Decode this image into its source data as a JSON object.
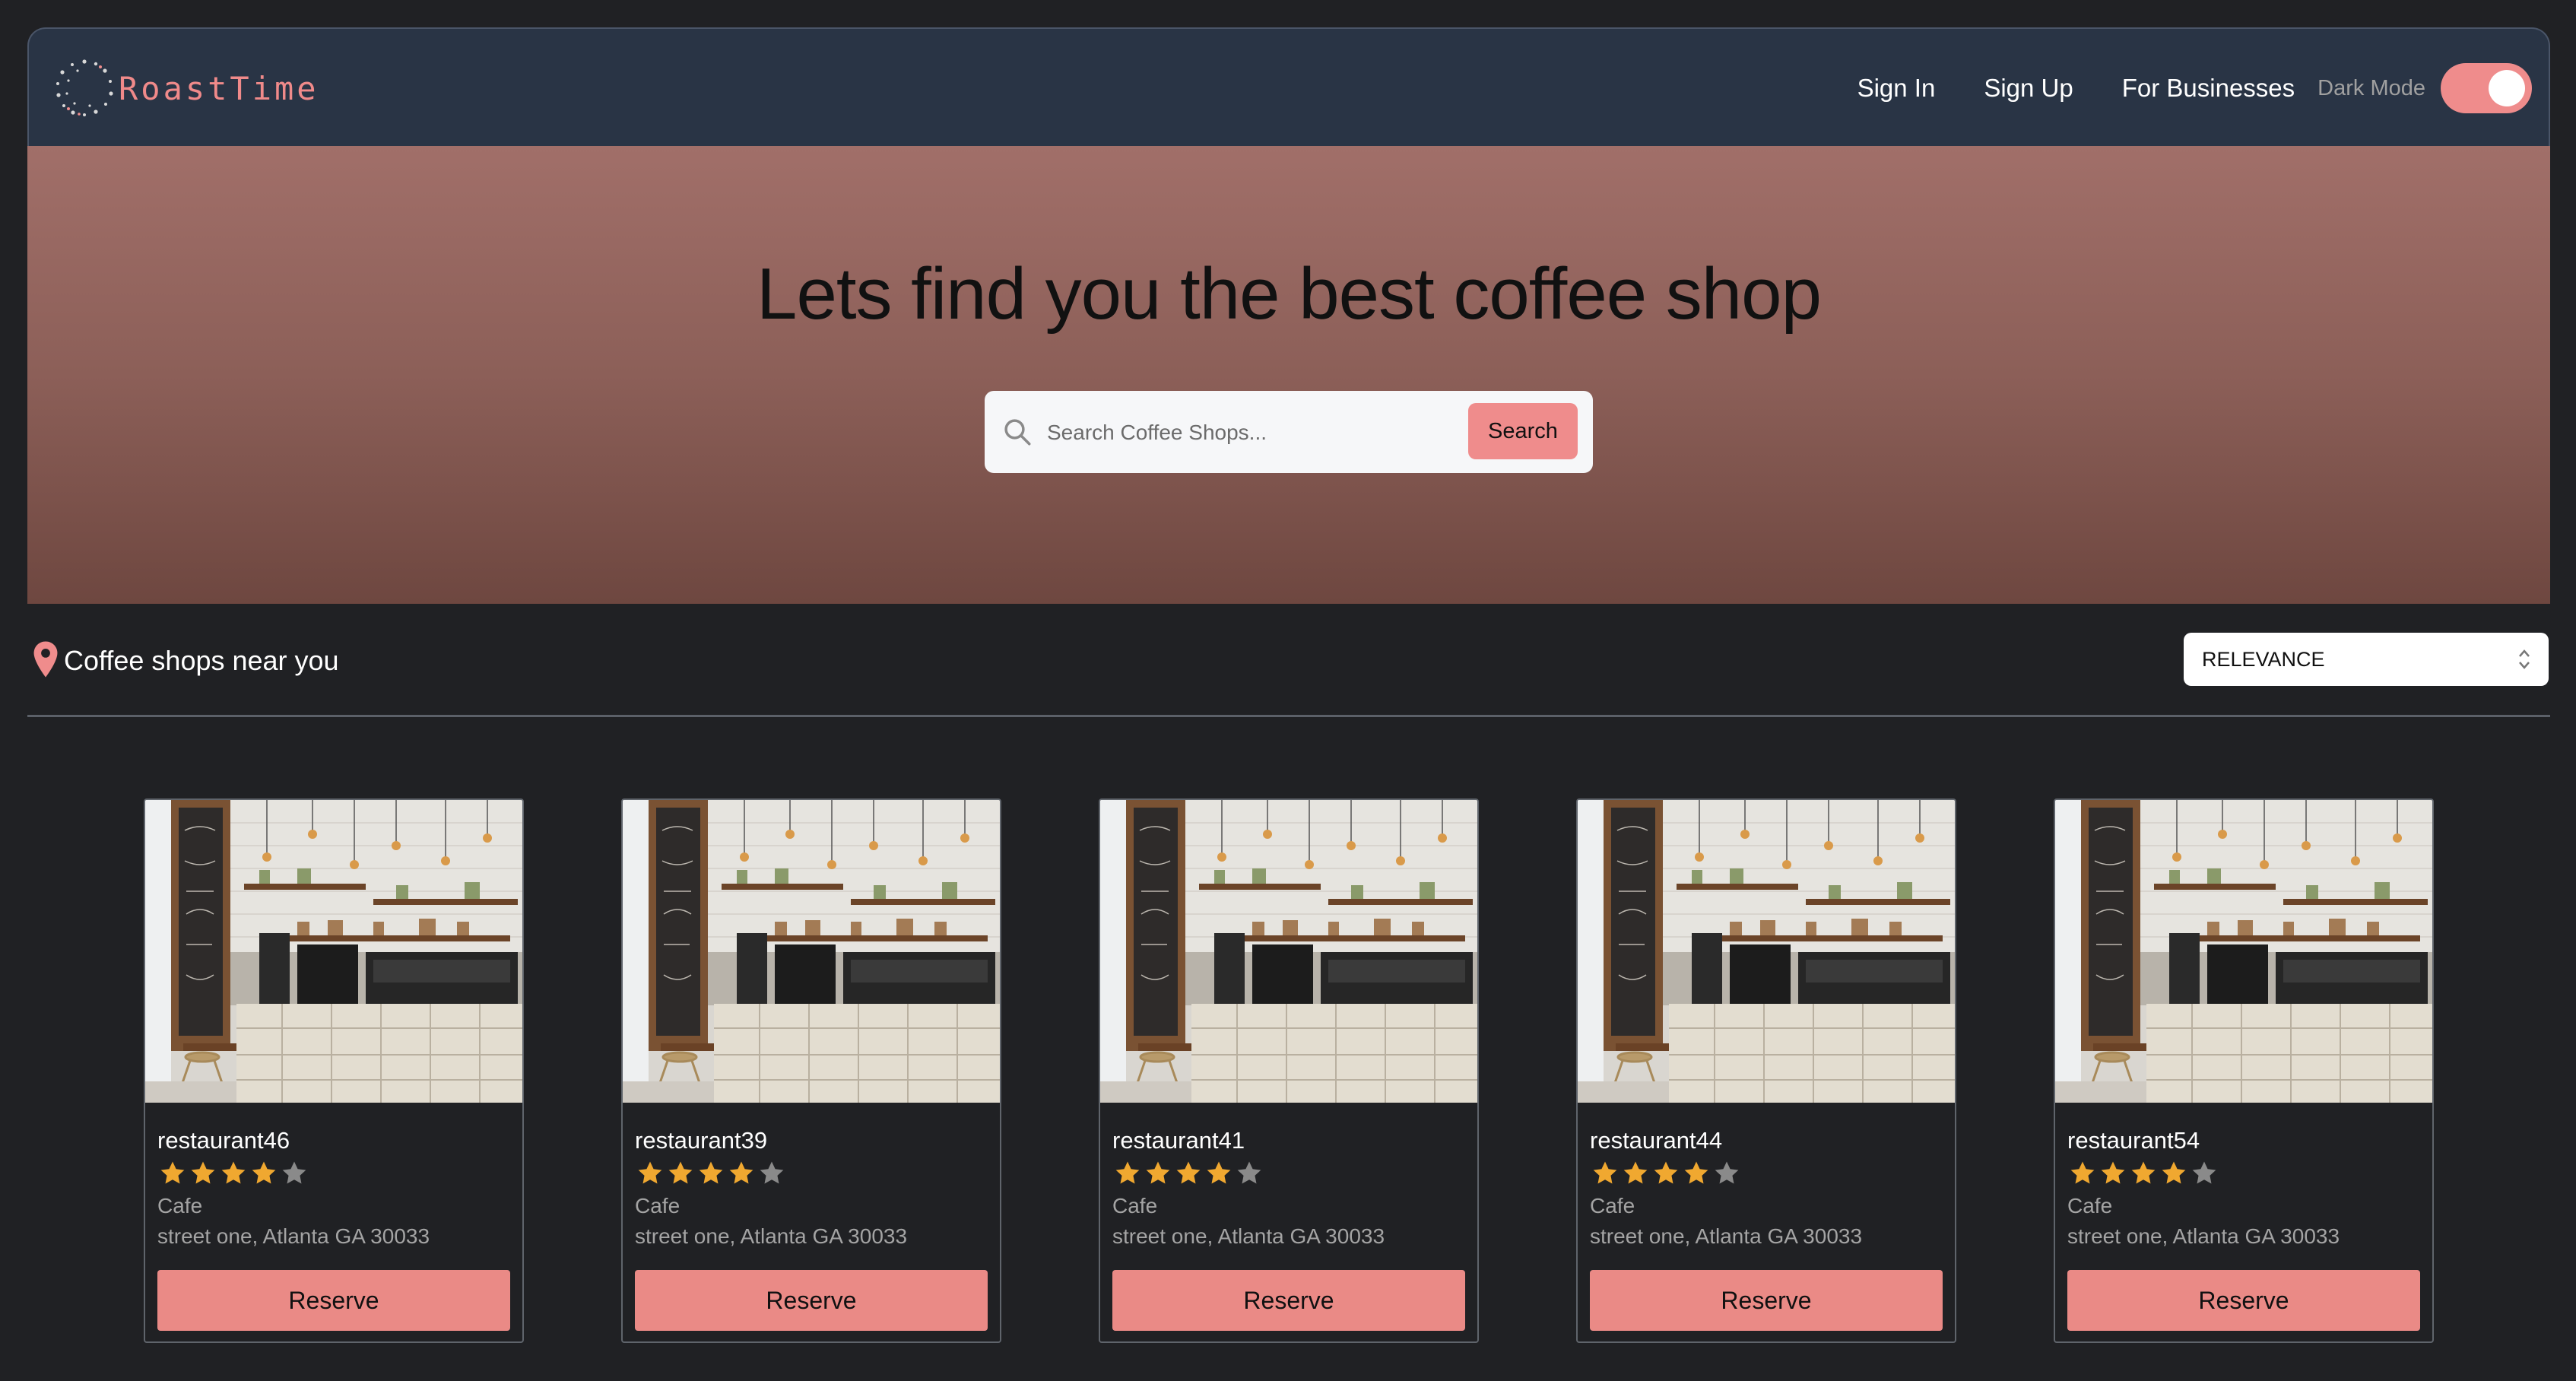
{
  "header": {
    "logo_text": "RoastTime",
    "nav": {
      "sign_in": "Sign In",
      "sign_up": "Sign Up",
      "for_businesses": "For Businesses"
    },
    "dark_mode_label": "Dark Mode",
    "dark_mode_on": true
  },
  "hero": {
    "title": "Lets find you the best coffee shop",
    "search": {
      "placeholder": "Search Coffee Shops...",
      "value": "",
      "button_label": "Search",
      "icon": "magnifier-icon"
    }
  },
  "listing": {
    "section_title": "Coffee shops near you",
    "location_icon": "map-pin-icon",
    "sort": {
      "selected": "RELEVANCE"
    },
    "cards": [
      {
        "name": "restaurant46",
        "rating": 4,
        "max_rating": 5,
        "type": "Cafe",
        "address": "street one, Atlanta GA 30033",
        "button_label": "Reserve"
      },
      {
        "name": "restaurant39",
        "rating": 4,
        "max_rating": 5,
        "type": "Cafe",
        "address": "street one, Atlanta GA 30033",
        "button_label": "Reserve"
      },
      {
        "name": "restaurant41",
        "rating": 4,
        "max_rating": 5,
        "type": "Cafe",
        "address": "street one, Atlanta GA 30033",
        "button_label": "Reserve"
      },
      {
        "name": "restaurant44",
        "rating": 4,
        "max_rating": 5,
        "type": "Cafe",
        "address": "street one, Atlanta GA 30033",
        "button_label": "Reserve"
      },
      {
        "name": "restaurant54",
        "rating": 4,
        "max_rating": 5,
        "type": "Cafe",
        "address": "street one, Atlanta GA 30033",
        "button_label": "Reserve"
      }
    ]
  },
  "colors": {
    "page_background": "#202124",
    "header_background": "#293445",
    "accent": "#ef8c8c",
    "star_filled": "#f0a830",
    "star_empty": "#8a8a8a",
    "muted_text": "#a4a4a4"
  }
}
